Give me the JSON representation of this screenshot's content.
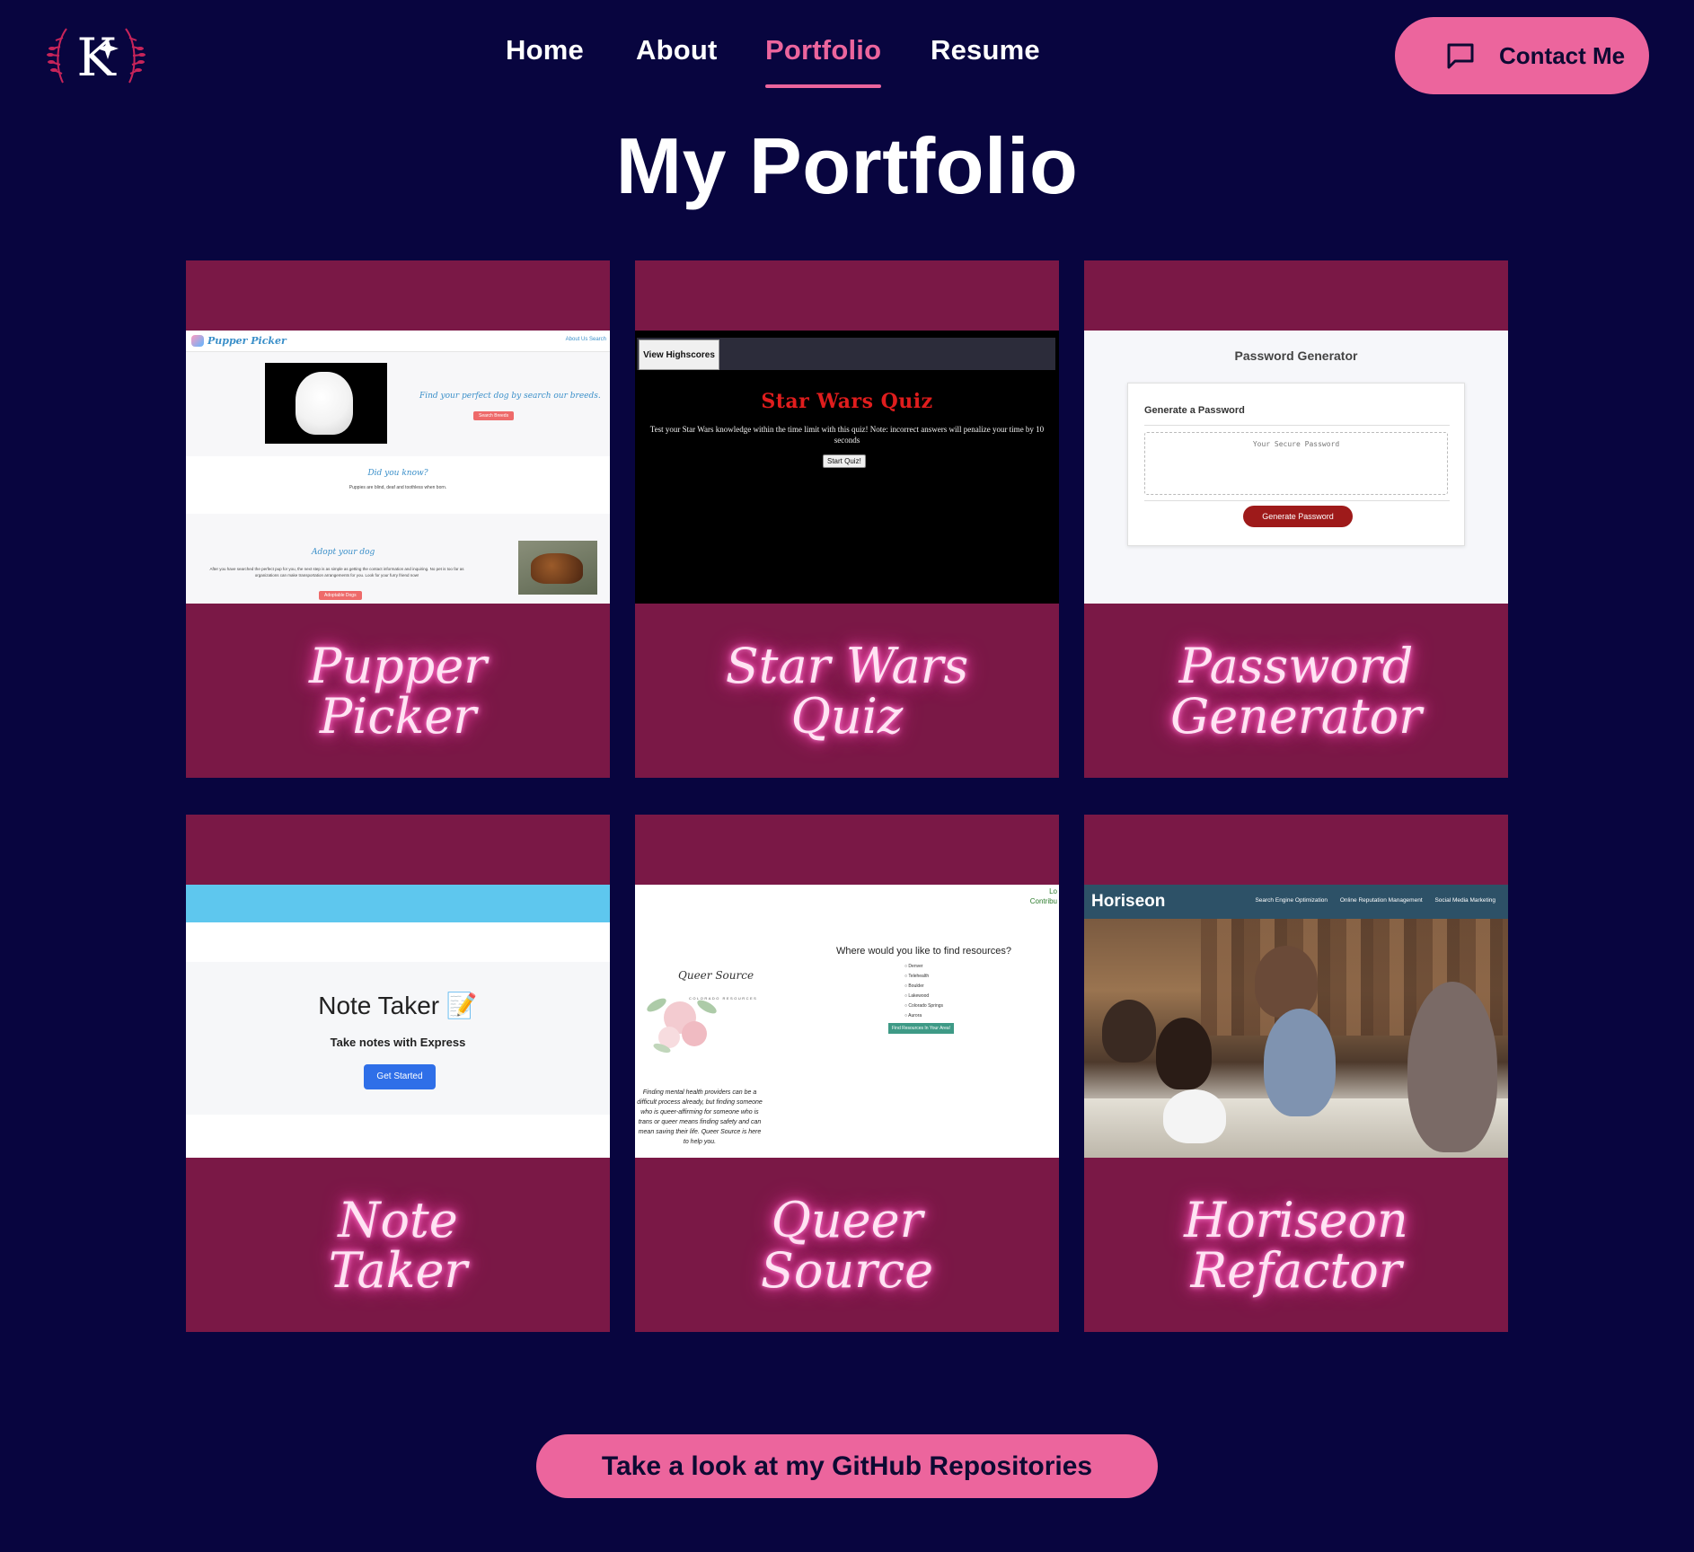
{
  "nav": {
    "logo_letter": "K",
    "links": [
      {
        "label": "Home"
      },
      {
        "label": "About"
      },
      {
        "label": "Portfolio"
      },
      {
        "label": "Resume"
      }
    ],
    "contact_label": "Contact Me"
  },
  "page_title": "My Portfolio",
  "projects": [
    {
      "caption_line1": "Pupper",
      "caption_line2": "Picker",
      "preview": {
        "brand": "Pupper Picker",
        "links": "About Us  Search",
        "hero": "Find your perfect dog by search our breeds.",
        "hero_button": "Search Breeds",
        "fact_title": "Did you know?",
        "fact_text": "Puppies are blind, deaf and toothless when born.",
        "adopt_title": "Adopt your dog",
        "adopt_text": "After you have searched the perfect pup for you, the next step is as simple as getting the contact information and inquiring. No pet is too far as organizations can make transportation arrangements for you. Look for your furry friend now!",
        "adopt_button": "Adoptable Dogs"
      }
    },
    {
      "caption_line1": "Star Wars",
      "caption_line2": "Quiz",
      "preview": {
        "highscores": "View Highscores",
        "title": "Star Wars Quiz",
        "desc": "Test your Star Wars knowledge within the time limit with this quiz! Note: incorrect answers will penalize your time by 10 seconds",
        "start": "Start Quiz!"
      }
    },
    {
      "caption_line1": "Password",
      "caption_line2": "Generator",
      "preview": {
        "title": "Password Generator",
        "card_title": "Generate a Password",
        "placeholder": "Your Secure Password",
        "button": "Generate Password"
      }
    },
    {
      "caption_line1": "Note",
      "caption_line2": "Taker",
      "preview": {
        "title": "Note Taker 📝",
        "sub": "Take notes with Express",
        "button": "Get Started"
      }
    },
    {
      "caption_line1": "Queer",
      "caption_line2": "Source",
      "preview": {
        "top_right_1": "Lo",
        "top_right_2": "Contribu",
        "logo": "Queer Source",
        "logo_sub": "COLORADO RESOURCES",
        "question": "Where would you like to find resources?",
        "options": [
          "Denver",
          "Telehealth",
          "Boulder",
          "Lakewood",
          "Colorado Springs",
          "Aurora"
        ],
        "find_button": "Find Resources In Your Area!",
        "para": "Finding mental health providers can be a difficult process already, but finding someone who is queer-affirming for someone who is trans or queer means finding safety and can mean saving their life. Queer Source is here to help you."
      }
    },
    {
      "caption_line1": "Horiseon",
      "caption_line2": "Refactor",
      "preview": {
        "brand": "Horiseon",
        "menu": [
          "Search Engine Optimization",
          "Online Reputation Management",
          "Social Media Marketing"
        ]
      }
    }
  ],
  "github_label": "Take a look at my GitHub Repositories",
  "colors": {
    "background": "#08053f",
    "accent": "#ec659d",
    "card": "#7a1846",
    "glow": "#ff4fb8"
  }
}
